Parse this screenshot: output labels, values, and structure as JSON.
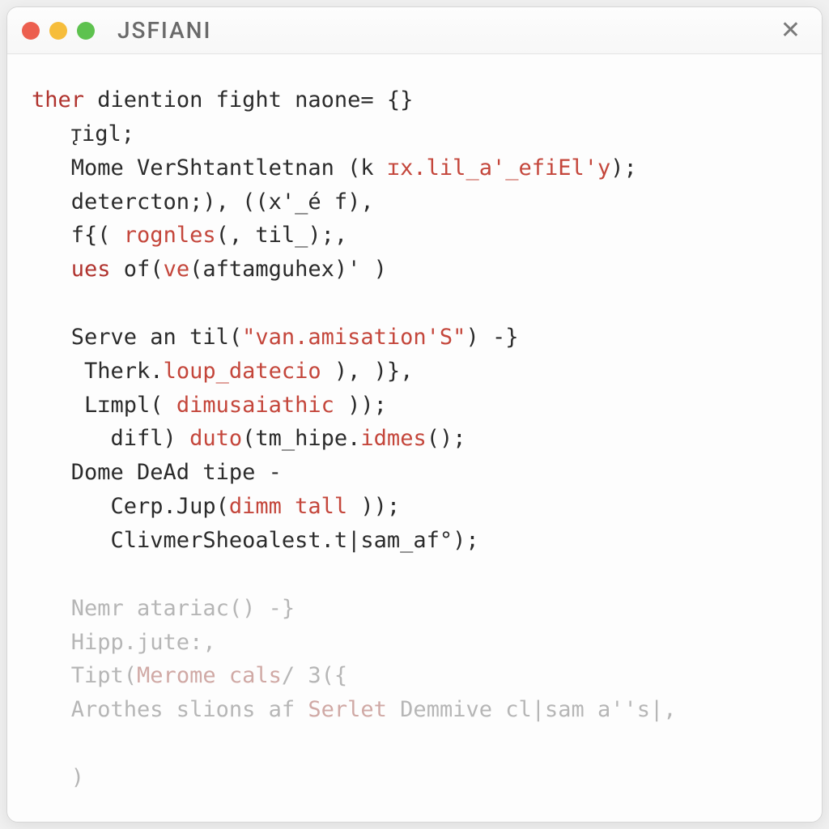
{
  "window": {
    "title": "JSFIANI"
  },
  "code": {
    "l1_kw": "ther",
    "l1_rest": " diention fight naone",
    "l1_assign": "= {}",
    "l2": "   ꚑigl;",
    "l3_a": "   Mome VerShtantletnan (k ",
    "l3_b": "ɪx.lil_a'_efiEl'y",
    "l3_c": ");",
    "l4": "   detercton;), ((x'_é f),",
    "l5_a": "   f{( ",
    "l5_b": "rognles",
    "l5_c": "(, til_);,",
    "l6_kw": "   ues",
    "l6_a": " of(",
    "l6_b": "ve",
    "l6_c": "(aftamguhex)' )",
    "blank1": "",
    "l7_a": "   Serve an til(",
    "l7_str": "\"van.amisation'S\"",
    "l7_b": ") -}",
    "l8_a": "    Therk.",
    "l8_b": "loup_datecio",
    "l8_c": " ), )},",
    "l9_a": "    Lɪmpl( ",
    "l9_b": "dimusaiathic",
    "l9_c": " ));",
    "l10_a": "      difl) ",
    "l10_b": "duto",
    "l10_c": "(tm_hipe.",
    "l10_d": "idmes",
    "l10_e": "();",
    "l11": "   Dome DeAd tipe -",
    "l12_a": "      Cerp.Jup(",
    "l12_b": "dimm tall",
    "l12_c": " ));",
    "l13": "      ClivmerSheoalest.t|sam_af°);",
    "blank2": "",
    "m1": "   Nemr atariac() -}",
    "m2": "   Hipp.jute:,",
    "m3_a": "   Tipt(",
    "m3_b": "Merome cals",
    "m3_c": "/ 3({",
    "m4_a": "   Arothes slions af ",
    "m4_b": "Serlet",
    "m4_c": " Demmive cl|sam a''s|,",
    "blank3": "",
    "m5": "   )"
  }
}
